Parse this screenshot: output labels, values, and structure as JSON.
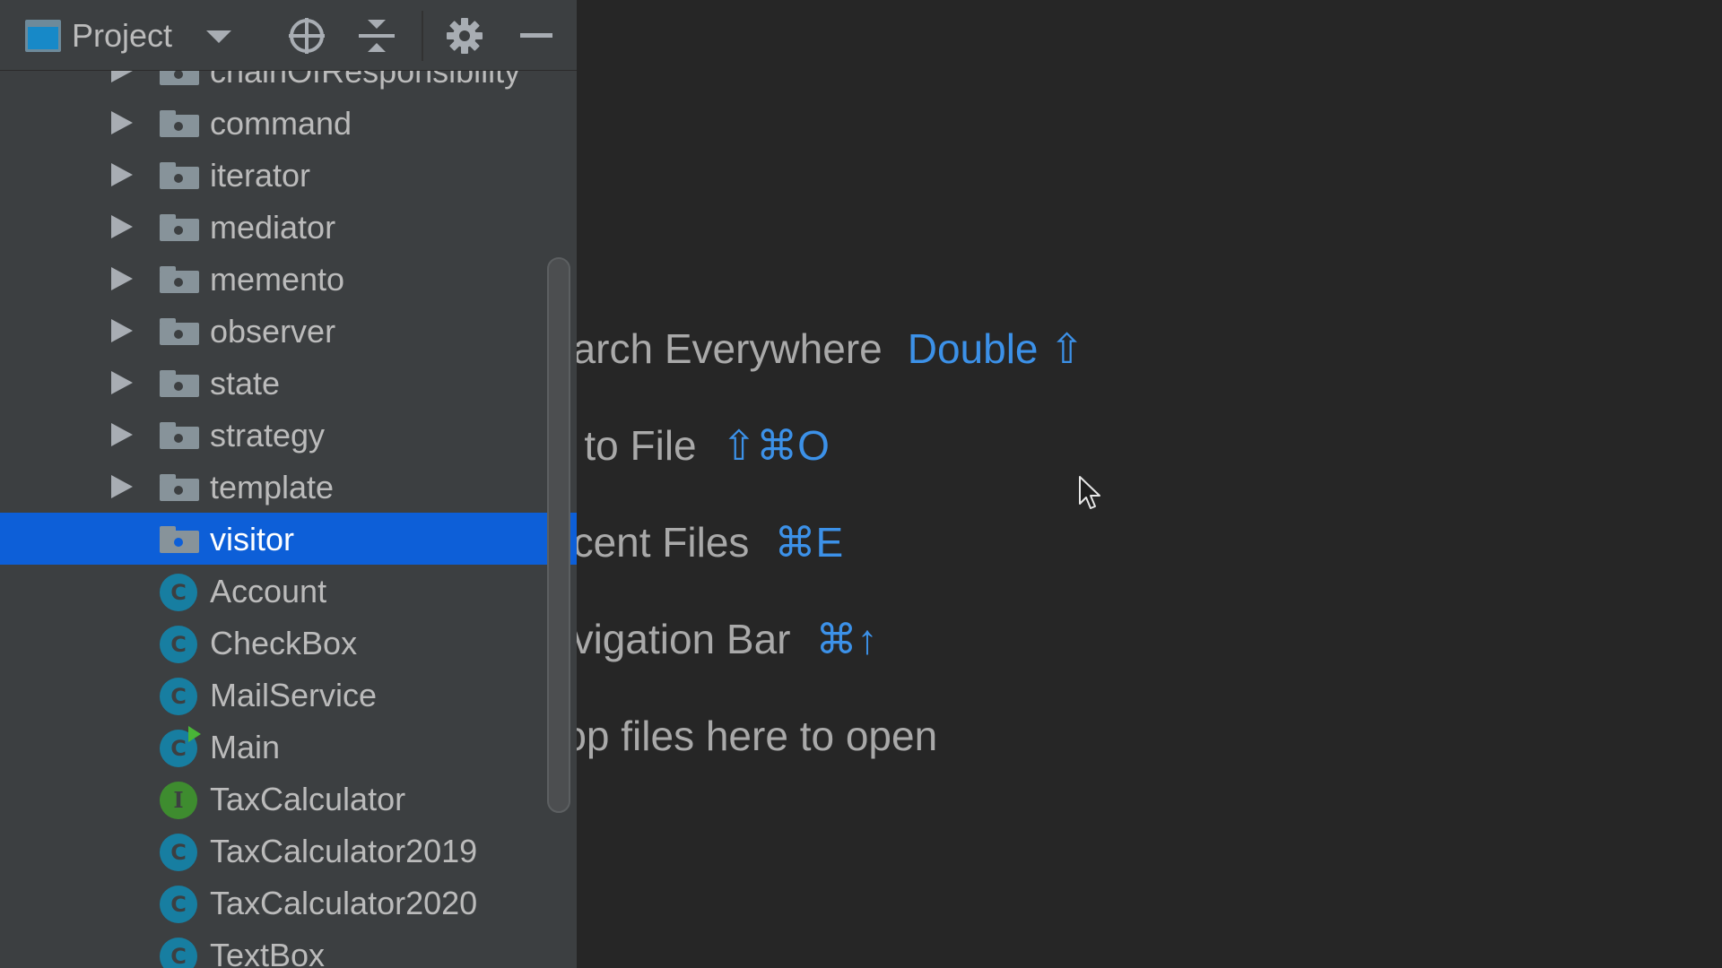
{
  "project_panel": {
    "title": "Project",
    "icons": {
      "window": "project-window-icon",
      "dropdown": "chevron-down-icon",
      "locate": "locate-target-icon",
      "collapse": "collapse-all-icon",
      "settings": "gear-icon",
      "hide": "minimize-icon"
    },
    "tree": [
      {
        "label": "chainOfResponsibility",
        "kind": "package",
        "expandable": true,
        "selected": false
      },
      {
        "label": "command",
        "kind": "package",
        "expandable": true,
        "selected": false
      },
      {
        "label": "iterator",
        "kind": "package",
        "expandable": true,
        "selected": false
      },
      {
        "label": "mediator",
        "kind": "package",
        "expandable": true,
        "selected": false
      },
      {
        "label": "memento",
        "kind": "package",
        "expandable": true,
        "selected": false
      },
      {
        "label": "observer",
        "kind": "package",
        "expandable": true,
        "selected": false
      },
      {
        "label": "state",
        "kind": "package",
        "expandable": true,
        "selected": false
      },
      {
        "label": "strategy",
        "kind": "package",
        "expandable": true,
        "selected": false
      },
      {
        "label": "template",
        "kind": "package",
        "expandable": true,
        "selected": false
      },
      {
        "label": "visitor",
        "kind": "package",
        "expandable": false,
        "selected": true
      },
      {
        "label": "Account",
        "kind": "class",
        "icon_letter": "C"
      },
      {
        "label": "CheckBox",
        "kind": "class",
        "icon_letter": "C"
      },
      {
        "label": "MailService",
        "kind": "class",
        "icon_letter": "C"
      },
      {
        "label": "Main",
        "kind": "class-runnable",
        "icon_letter": "C"
      },
      {
        "label": "TaxCalculator",
        "kind": "interface",
        "icon_letter": "I"
      },
      {
        "label": "TaxCalculator2019",
        "kind": "class",
        "icon_letter": "C"
      },
      {
        "label": "TaxCalculator2020",
        "kind": "class",
        "icon_letter": "C"
      },
      {
        "label": "TextBox",
        "kind": "class",
        "icon_letter": "C"
      }
    ]
  },
  "editor_hints": [
    {
      "label": "earch Everywhere",
      "shortcut": "Double ⇧"
    },
    {
      "label": "o to File",
      "shortcut": "⇧⌘O"
    },
    {
      "label": "ecent Files",
      "shortcut": "⌘E"
    },
    {
      "label": "avigation Bar",
      "shortcut": "⌘↑"
    },
    {
      "label": "rop files here to open",
      "shortcut": ""
    }
  ],
  "colors": {
    "panel_bg": "#3c3f41",
    "editor_bg": "#262626",
    "selection": "#0d5fd8",
    "shortcut": "#3c91e8",
    "class_icon": "#177ea1",
    "interface_icon": "#3e8c2f"
  }
}
